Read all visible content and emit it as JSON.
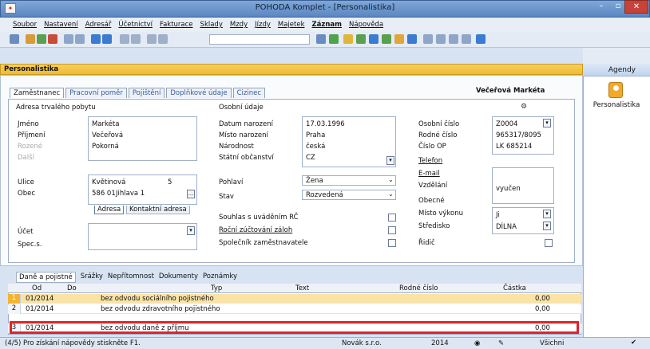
{
  "window": {
    "title": "POHODA Komplet - [Personalistika]"
  },
  "menu": [
    "Soubor",
    "Nastavení",
    "Adresář",
    "Účetnictví",
    "Fakturace",
    "Sklady",
    "Mzdy",
    "Jízdy",
    "Majetek",
    "Záznam",
    "Nápověda"
  ],
  "agenda": {
    "header": "Agendy",
    "item": "Personalistika"
  },
  "module": {
    "title": "Personalistika"
  },
  "tabs": [
    "Zaměstnanec",
    "Pracovní poměr",
    "Pojištění",
    "Doplňkové údaje",
    "Cizinec"
  ],
  "person_name": "Večeřová Markéta",
  "address": {
    "section": "Adresa trvalého pobytu",
    "labels": {
      "first": "Jméno",
      "last": "Příjmení",
      "maiden": "Rozené",
      "other": "Další",
      "street": "Ulice",
      "city": "Obec",
      "account": "Účet",
      "spec": "Spec.s."
    },
    "first": "Markéta",
    "last": "Večeřová",
    "maiden": "Pokorná",
    "street": "Květinová",
    "house_no": "5",
    "zip": "586 01",
    "city": "Jihlava 1",
    "addr_tab": "Adresa",
    "contact_tab": "Kontaktní adresa"
  },
  "personal": {
    "section": "Osobní údaje",
    "labels": {
      "dob": "Datum narození",
      "pob": "Místo narození",
      "nationality": "Národnost",
      "citizenship": "Státní občanství",
      "sex": "Pohlaví",
      "status": "Stav",
      "consent": "Souhlas s uváděním RČ",
      "annual": "Roční zúčtování záloh",
      "partner": "Společník zaměstnavatele"
    },
    "dob": "17.03.1996",
    "pob": "Praha",
    "nationality": "česká",
    "citizenship": "CZ",
    "sex": "Žena",
    "status": "Rozvedená"
  },
  "ids": {
    "labels": {
      "personal_no": "Osobní číslo",
      "birth_no": "Rodné číslo",
      "id_card": "Číslo OP",
      "phone": "Telefon",
      "email": "E-mail",
      "education": "Vzdělání",
      "municipality": "Obecné",
      "workplace": "Místo výkonu",
      "center": "Středisko",
      "driver": "Řidič"
    },
    "personal_no": "Z0004",
    "birth_no": "965317/8095",
    "id_card": "LK 685214",
    "education": "vyučen",
    "workplace": "Ji",
    "center": "DÍLNA"
  },
  "subtabs": [
    "Daně a pojistné",
    "Srážky",
    "Nepřítomnost",
    "Dokumenty",
    "Poznámky"
  ],
  "grid": {
    "columns": [
      "Od",
      "Do",
      "Typ",
      "Text",
      "Rodné číslo",
      "Částka"
    ],
    "rows": [
      {
        "n": "1",
        "od": "01/2014",
        "typ": "bez odvodu sociálního pojistného",
        "castka": "0,00"
      },
      {
        "n": "2",
        "od": "01/2014",
        "typ": "bez odvodu zdravotního pojistného",
        "castka": "0,00"
      },
      {
        "n": "3",
        "od": "01/2014",
        "typ": "bez odvodu daně z příjmu",
        "castka": "0,00"
      }
    ]
  },
  "status": {
    "hint": "(4/5) Pro získání nápovědy stiskněte F1.",
    "company": "Novák s.r.o.",
    "year": "2014",
    "filter": "Všichni"
  },
  "colors": {
    "highlight": "#e2222a",
    "accent": "#f4b430"
  }
}
